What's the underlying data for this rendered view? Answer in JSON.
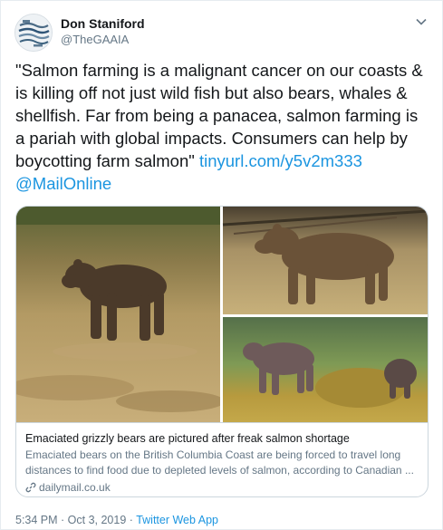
{
  "tweet": {
    "author_name": "Don Staniford",
    "author_handle": "@TheGAAIA",
    "text": "\"Salmon farming is a malignant cancer on our coasts & is killing off not just wild fish but also bears, whales & shellfish. Far from being a panacea, salmon farming is a pariah with global impacts. Consumers can help by boycotting farm salmon\"",
    "link": "tinyurl.com/y5v2m333",
    "mention": "@MailOnline"
  },
  "card": {
    "title": "Emaciated grizzly bears are pictured after freak salmon shortage",
    "description": "Emaciated bears on the British Columbia Coast are being forced to travel long distances to find food due to depleted levels of salmon, according to Canadian ...",
    "domain": "dailymail.co.uk"
  },
  "footer": {
    "timestamp": "5:34 PM · Oct 3, 2019",
    "separator": " · ",
    "source": "Twitter Web App"
  },
  "colors": {
    "link": "#1b95e0",
    "secondary_text": "#657786",
    "border": "#ccd6dd"
  },
  "icons": {
    "menu": "chevron-down-icon",
    "card_link": "link-icon"
  }
}
